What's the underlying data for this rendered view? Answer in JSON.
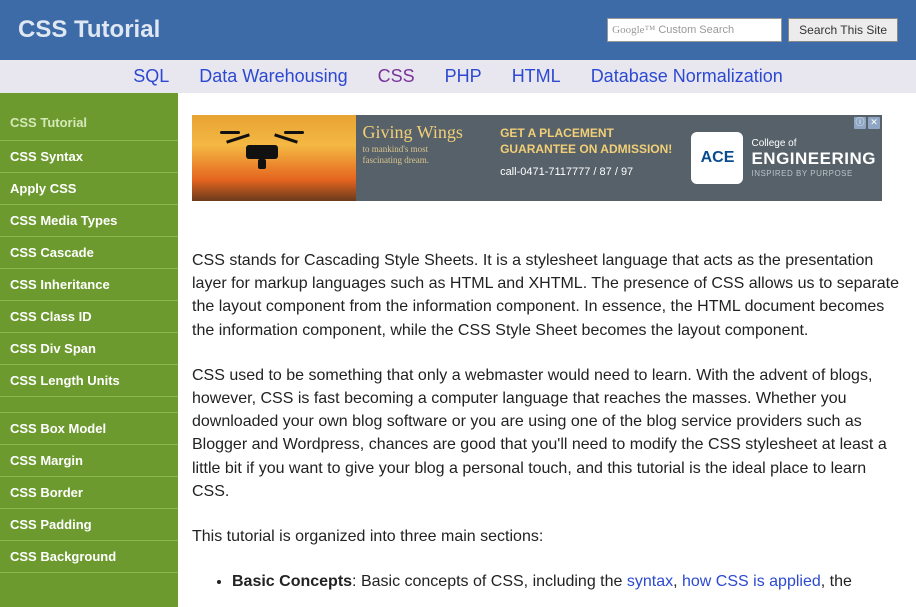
{
  "header": {
    "title": "CSS Tutorial",
    "search_logo": "Google™",
    "search_placeholder": "Custom Search",
    "search_button": "Search This Site"
  },
  "topnav": {
    "items": [
      "SQL",
      "Data Warehousing",
      "CSS",
      "PHP",
      "HTML",
      "Database Normalization"
    ],
    "current_index": 2
  },
  "sidebar": {
    "title": "CSS Tutorial",
    "g1": [
      "CSS Syntax",
      "Apply CSS",
      "CSS Media Types",
      "CSS Cascade",
      "CSS Inheritance",
      "CSS Class ID",
      "CSS Div Span",
      "CSS Length Units"
    ],
    "g2": [
      "CSS Box Model",
      "CSS Margin",
      "CSS Border",
      "CSS Padding",
      "CSS Background"
    ]
  },
  "ad": {
    "script_line": "Giving Wings",
    "script_sub1": "to mankind's most",
    "script_sub2": "fascinating dream.",
    "line1": "GET A PLACEMENT",
    "line2": "GUARANTEE ON ADMISSION!",
    "phone": "call-0471-7117777 / 87 / 97",
    "logo_sq": "ACE",
    "logo_top": "College of",
    "logo_big": "ENGINEERING",
    "logo_sm": "INSPIRED BY PURPOSE",
    "close": "✕",
    "info": "ⓘ"
  },
  "content": {
    "p1": "CSS stands for Cascading Style Sheets. It is a stylesheet language that acts as the presentation layer for markup languages such as HTML and XHTML. The presence of CSS allows us to separate the layout component from the information component. In essence, the HTML document becomes the information component, while the CSS Style Sheet becomes the layout component.",
    "p2": "CSS used to be something that only a webmaster would need to learn. With the advent of blogs, however, CSS is fast becoming a computer language that reaches the masses. Whether you downloaded your own blog software or you are using one of the blog service providers such as Blogger and Wordpress, chances are good that you'll need to modify the CSS stylesheet at least a little bit if you want to give your blog a personal touch, and this tutorial is the ideal place to learn CSS.",
    "p3": "This tutorial is organized into three main sections:",
    "bullet_label": "Basic Concepts",
    "bullet_pre": ": Basic concepts of CSS, including the ",
    "link1": "syntax",
    "bullet_mid": ", ",
    "link2": "how CSS is applied",
    "bullet_tail": ", the"
  }
}
